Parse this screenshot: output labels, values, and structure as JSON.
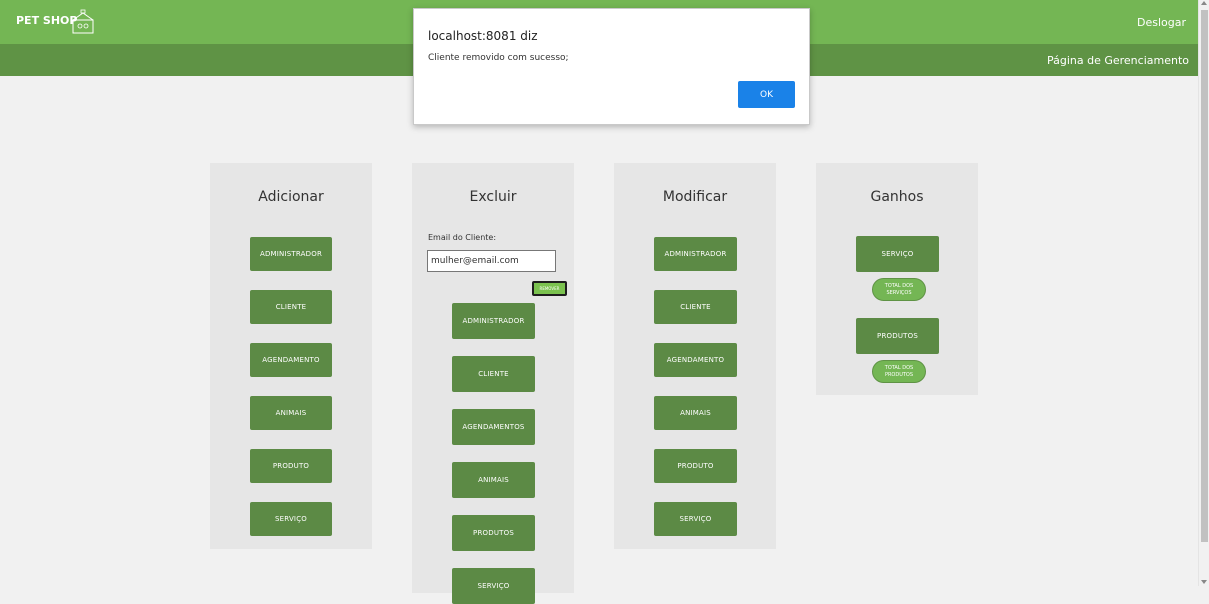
{
  "header": {
    "brand": "PET SHOP",
    "logout": "Deslogar",
    "subtitle": "Página de Gerenciamento"
  },
  "panels": {
    "add": {
      "title": "Adicionar",
      "buttons": [
        "ADMINISTRADOR",
        "CLIENTE",
        "AGENDAMENTO",
        "ANIMAIS",
        "PRODUTO",
        "SERVIÇO"
      ]
    },
    "delete": {
      "title": "Excluir",
      "email_label": "Email do Cliente:",
      "email_value": "mulher@email.com",
      "remove_label": "REMOVER",
      "buttons": [
        "ADMINISTRADOR",
        "CLIENTE",
        "AGENDAMENTOS",
        "ANIMAIS",
        "PRODUTOS",
        "SERVIÇO"
      ]
    },
    "modify": {
      "title": "Modificar",
      "buttons": [
        "ADMINISTRADOR",
        "CLIENTE",
        "AGENDAMENTO",
        "ANIMAIS",
        "PRODUTO",
        "SERVIÇO"
      ]
    },
    "earnings": {
      "title": "Ganhos",
      "service_label": "SERVIÇO",
      "service_total": "TOTAL DOS SERVIÇOS",
      "products_label": "PRODUTOS",
      "products_total": "TOTAL DOS PRODUTOS"
    }
  },
  "dialog": {
    "title": "localhost:8081 diz",
    "message": "Cliente removido com sucesso;",
    "ok_label": "OK"
  },
  "colors": {
    "topbar": "#74b654",
    "subbar": "#5f9345",
    "button": "#5c8a45",
    "dialog_ok": "#1a82e8"
  }
}
